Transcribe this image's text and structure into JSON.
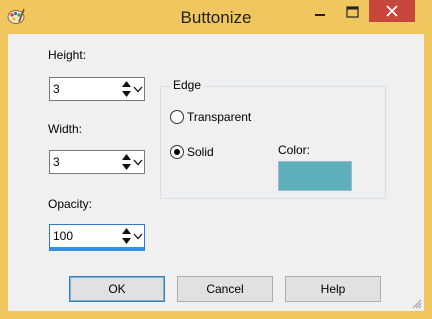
{
  "window": {
    "title": "Buttonize",
    "icon": "paint-palette-icon"
  },
  "fields": {
    "height": {
      "label": "Height:",
      "value": "3"
    },
    "width": {
      "label": "Width:",
      "value": "3"
    },
    "opacity": {
      "label": "Opacity:",
      "value": "100"
    }
  },
  "edge": {
    "title": "Edge",
    "options": [
      {
        "label": "Transparent",
        "selected": false
      },
      {
        "label": "Solid",
        "selected": true
      }
    ],
    "color_label": "Color:",
    "color": "#5fb0bd"
  },
  "buttons": {
    "ok": "OK",
    "cancel": "Cancel",
    "help": "Help"
  },
  "colors": {
    "title_bar": "#f0c75e",
    "close_button": "#c7463b",
    "dialog_bg": "#f0f0f0"
  }
}
